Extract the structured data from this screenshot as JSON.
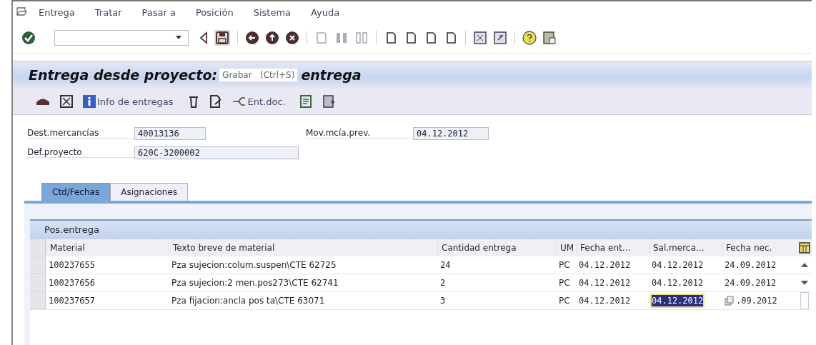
{
  "menu": [
    "Entrega",
    "Tratar",
    "Pasar a",
    "Posición",
    "Sistema",
    "Ayuda"
  ],
  "title": {
    "before": "Entrega desde proyecto:",
    "after": "entrega"
  },
  "tooltip": {
    "label": "Grabar",
    "shortcut": "(Ctrl+S)"
  },
  "app_toolbar": [
    {
      "kind": "icon"
    },
    {
      "kind": "icon"
    },
    {
      "kind": "labeled",
      "label": "Info de entregas"
    },
    {
      "kind": "icon"
    },
    {
      "kind": "icon"
    },
    {
      "kind": "labeled",
      "label": "Ent.doc."
    },
    {
      "kind": "icon"
    },
    {
      "kind": "icon"
    }
  ],
  "fields": [
    {
      "label": "Dest.mercancías",
      "value": "40013136"
    },
    {
      "label": "Def.proyecto",
      "value": "620C-3200002"
    },
    {
      "label": "Mov.mcía.prev.",
      "value": "04.12.2012"
    }
  ],
  "tabs": [
    {
      "label": "Ctd/Fechas",
      "selected": true
    },
    {
      "label": "Asignaciones",
      "selected": false
    }
  ],
  "table": {
    "title": "Pos.entrega",
    "columns": [
      "Material",
      "Texto breve de material",
      "Cantidad entrega",
      "UM",
      "Fecha ent…",
      "Sal.merca…",
      "Fecha nec."
    ],
    "rows": [
      {
        "material": "100237655",
        "text": "Pza sujecion:colum.suspen\\CTE 62725",
        "qty": "24",
        "um": "PC",
        "fecha_ent": "04.12.2012",
        "sal_merca": "04.12.2012",
        "sal_selected": false,
        "fecha_nec": "24.09.2012"
      },
      {
        "material": "100237656",
        "text": "Pza sujecion:2 men.pos273\\CTE 62741",
        "qty": "2",
        "um": "PC",
        "fecha_ent": "04.12.2012",
        "sal_merca": "04.12.2012",
        "sal_selected": false,
        "fecha_nec": "24.09.2012"
      },
      {
        "material": "100237657",
        "text": "Pza fijacion:ancla pos ta\\CTE 63071",
        "qty": "3",
        "um": "PC",
        "fecha_ent": "04.12.2012",
        "sal_merca": "04.12.2012",
        "sal_selected": true,
        "fecha_nec": ".09.2012"
      }
    ]
  }
}
